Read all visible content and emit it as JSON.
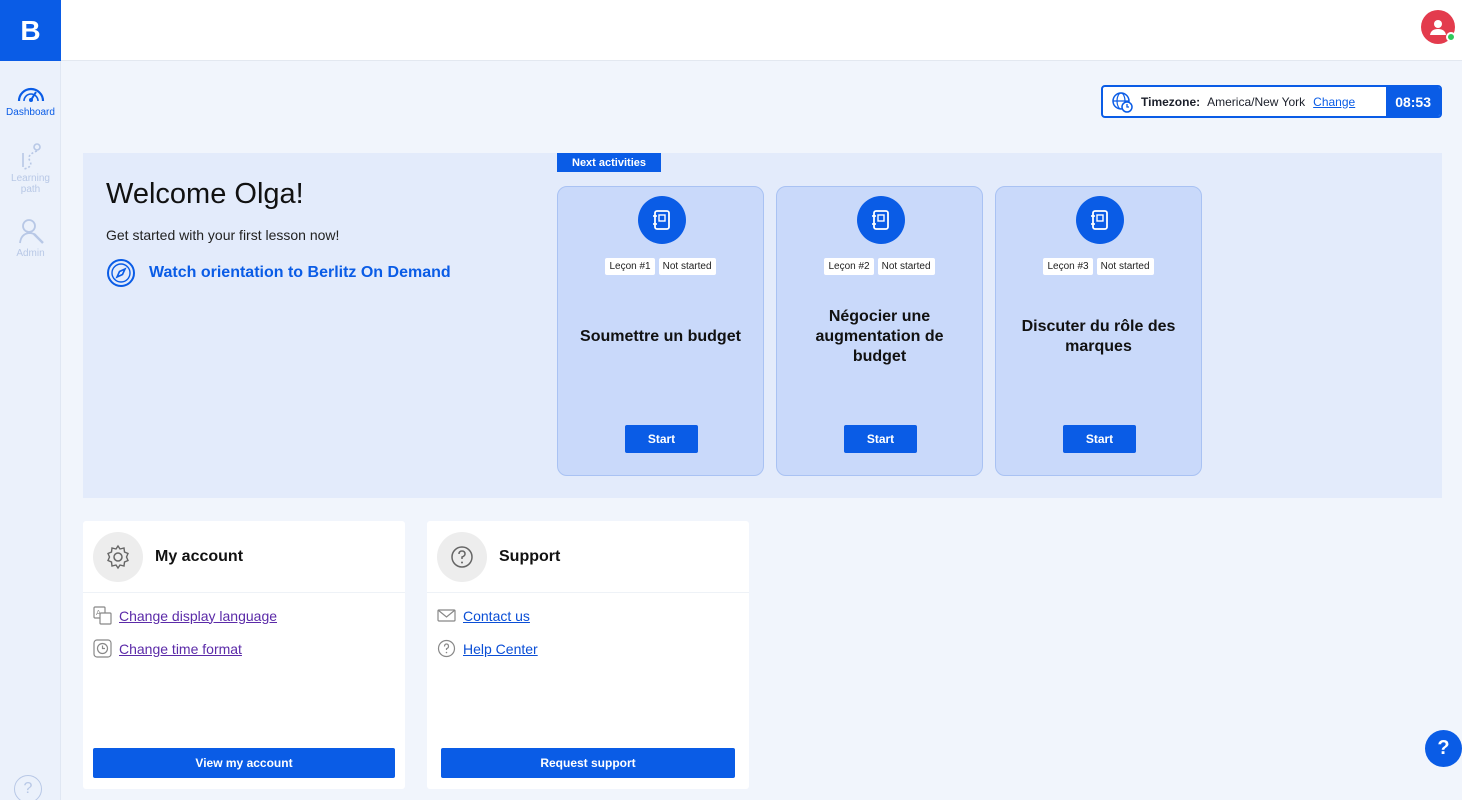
{
  "brand": {
    "logo_letter": "B",
    "primary_color": "#0a5ce6"
  },
  "sidebar": {
    "items": [
      {
        "label": "Dashboard",
        "icon": "gauge-icon",
        "active": true
      },
      {
        "label": "Learning path",
        "icon": "path-icon",
        "active": false
      },
      {
        "label": "Admin",
        "icon": "admin-icon",
        "active": false
      }
    ],
    "help_glyph": "?"
  },
  "header": {
    "avatar_status": "online"
  },
  "timezone": {
    "label": "Timezone:",
    "value": "America/New York",
    "change_label": "Change",
    "time": "08:53"
  },
  "hero": {
    "title": "Welcome Olga!",
    "subtitle": "Get started with your first lesson now!",
    "orientation_link": "Watch orientation to Berlitz On Demand",
    "next_tag": "Next activities",
    "cards": [
      {
        "lesson": "Leçon #1",
        "status": "Not started",
        "title": "Soumettre un budget",
        "button": "Start"
      },
      {
        "lesson": "Leçon #2",
        "status": "Not started",
        "title": "Négocier une augmentation de budget",
        "button": "Start"
      },
      {
        "lesson": "Leçon #3",
        "status": "Not started",
        "title": "Discuter du rôle des marques",
        "button": "Start"
      }
    ]
  },
  "account": {
    "title": "My account",
    "links": [
      "Change display language",
      "Change time format"
    ],
    "button": "View my account"
  },
  "support": {
    "title": "Support",
    "links": [
      "Contact us",
      "Help Center"
    ],
    "button": "Request support"
  },
  "help_fab": "?"
}
